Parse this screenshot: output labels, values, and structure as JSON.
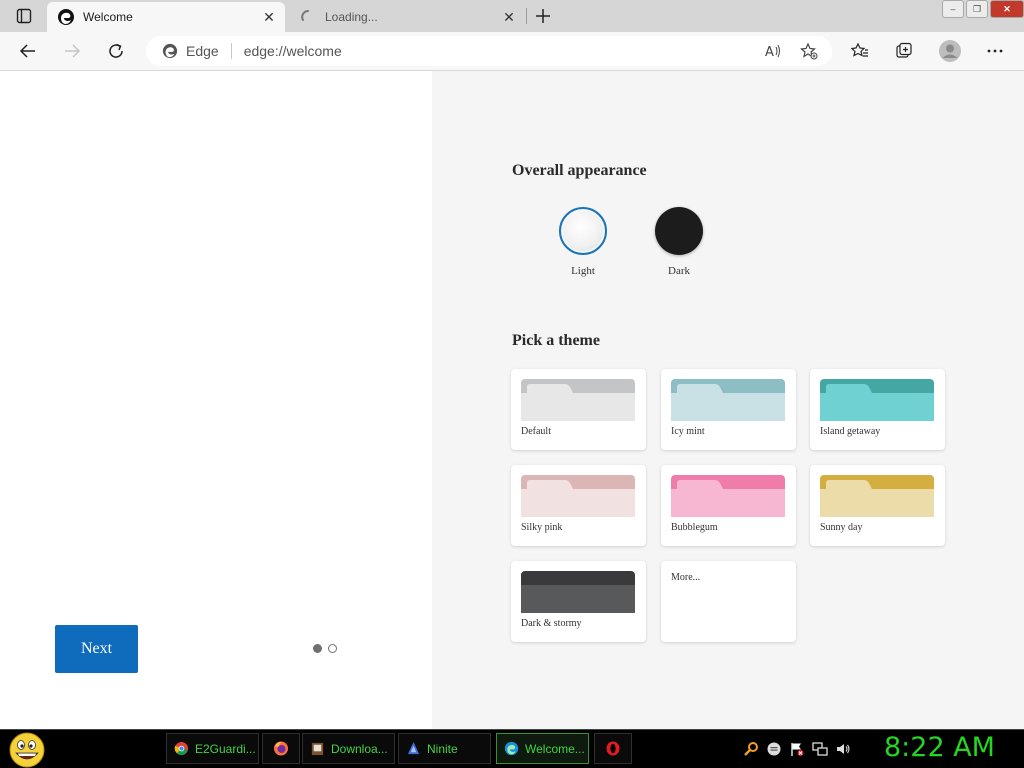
{
  "window": {
    "minimize_label": "–",
    "maximize_label": "❐",
    "close_label": "✕"
  },
  "tabs": [
    {
      "title": "Welcome",
      "close": "✕"
    },
    {
      "title": "Loading...",
      "close": "✕"
    }
  ],
  "toolbar": {
    "brand": "Edge",
    "url": "edge://welcome"
  },
  "onboarding": {
    "next_label": "Next",
    "pages": 2,
    "current_page": 1
  },
  "appearance": {
    "heading": "Overall appearance",
    "options": [
      {
        "label": "Light",
        "selected": true
      },
      {
        "label": "Dark",
        "selected": false
      }
    ]
  },
  "themes": {
    "heading": "Pick a theme",
    "items": [
      {
        "label": "Default",
        "back": "#c3c5c7",
        "front": "#e7e7e7",
        "tab": "#e7e7e7"
      },
      {
        "label": "Icy mint",
        "back": "#8dbdc5",
        "front": "#c9e1e5",
        "tab": "#c9e1e5"
      },
      {
        "label": "Island getaway",
        "back": "#45a7a3",
        "front": "#6fd1d2",
        "tab": "#6fd1d2"
      },
      {
        "label": "Silky pink",
        "back": "#dcb6b5",
        "front": "#f1e2e1",
        "tab": "#f1e2e1"
      },
      {
        "label": "Bubblegum",
        "back": "#f07caa",
        "front": "#f7b6d2",
        "tab": "#f7b6d2"
      },
      {
        "label": "Sunny day",
        "back": "#d4ae3f",
        "front": "#ecdcaa",
        "tab": "#ecdcaa"
      },
      {
        "label": "Dark & stormy",
        "back": "#3a3a3c",
        "front": "#58595b",
        "tab": "#3a3a3c"
      },
      {
        "label": "More..."
      }
    ]
  },
  "taskbar": {
    "items": [
      {
        "label": "E2Guardi...",
        "icon": "chrome-icon"
      },
      {
        "label": "",
        "icon": "firefox-icon"
      },
      {
        "label": "Downloa...",
        "icon": "download-icon"
      },
      {
        "label": "Ninite",
        "icon": "ninite-icon"
      },
      {
        "label": "Welcome...",
        "icon": "edge-icon"
      },
      {
        "label": "",
        "icon": "opera-icon"
      }
    ],
    "clock": "8:22 AM"
  },
  "colors": {
    "accent": "#0f6cbd",
    "clock": "#22d622"
  }
}
